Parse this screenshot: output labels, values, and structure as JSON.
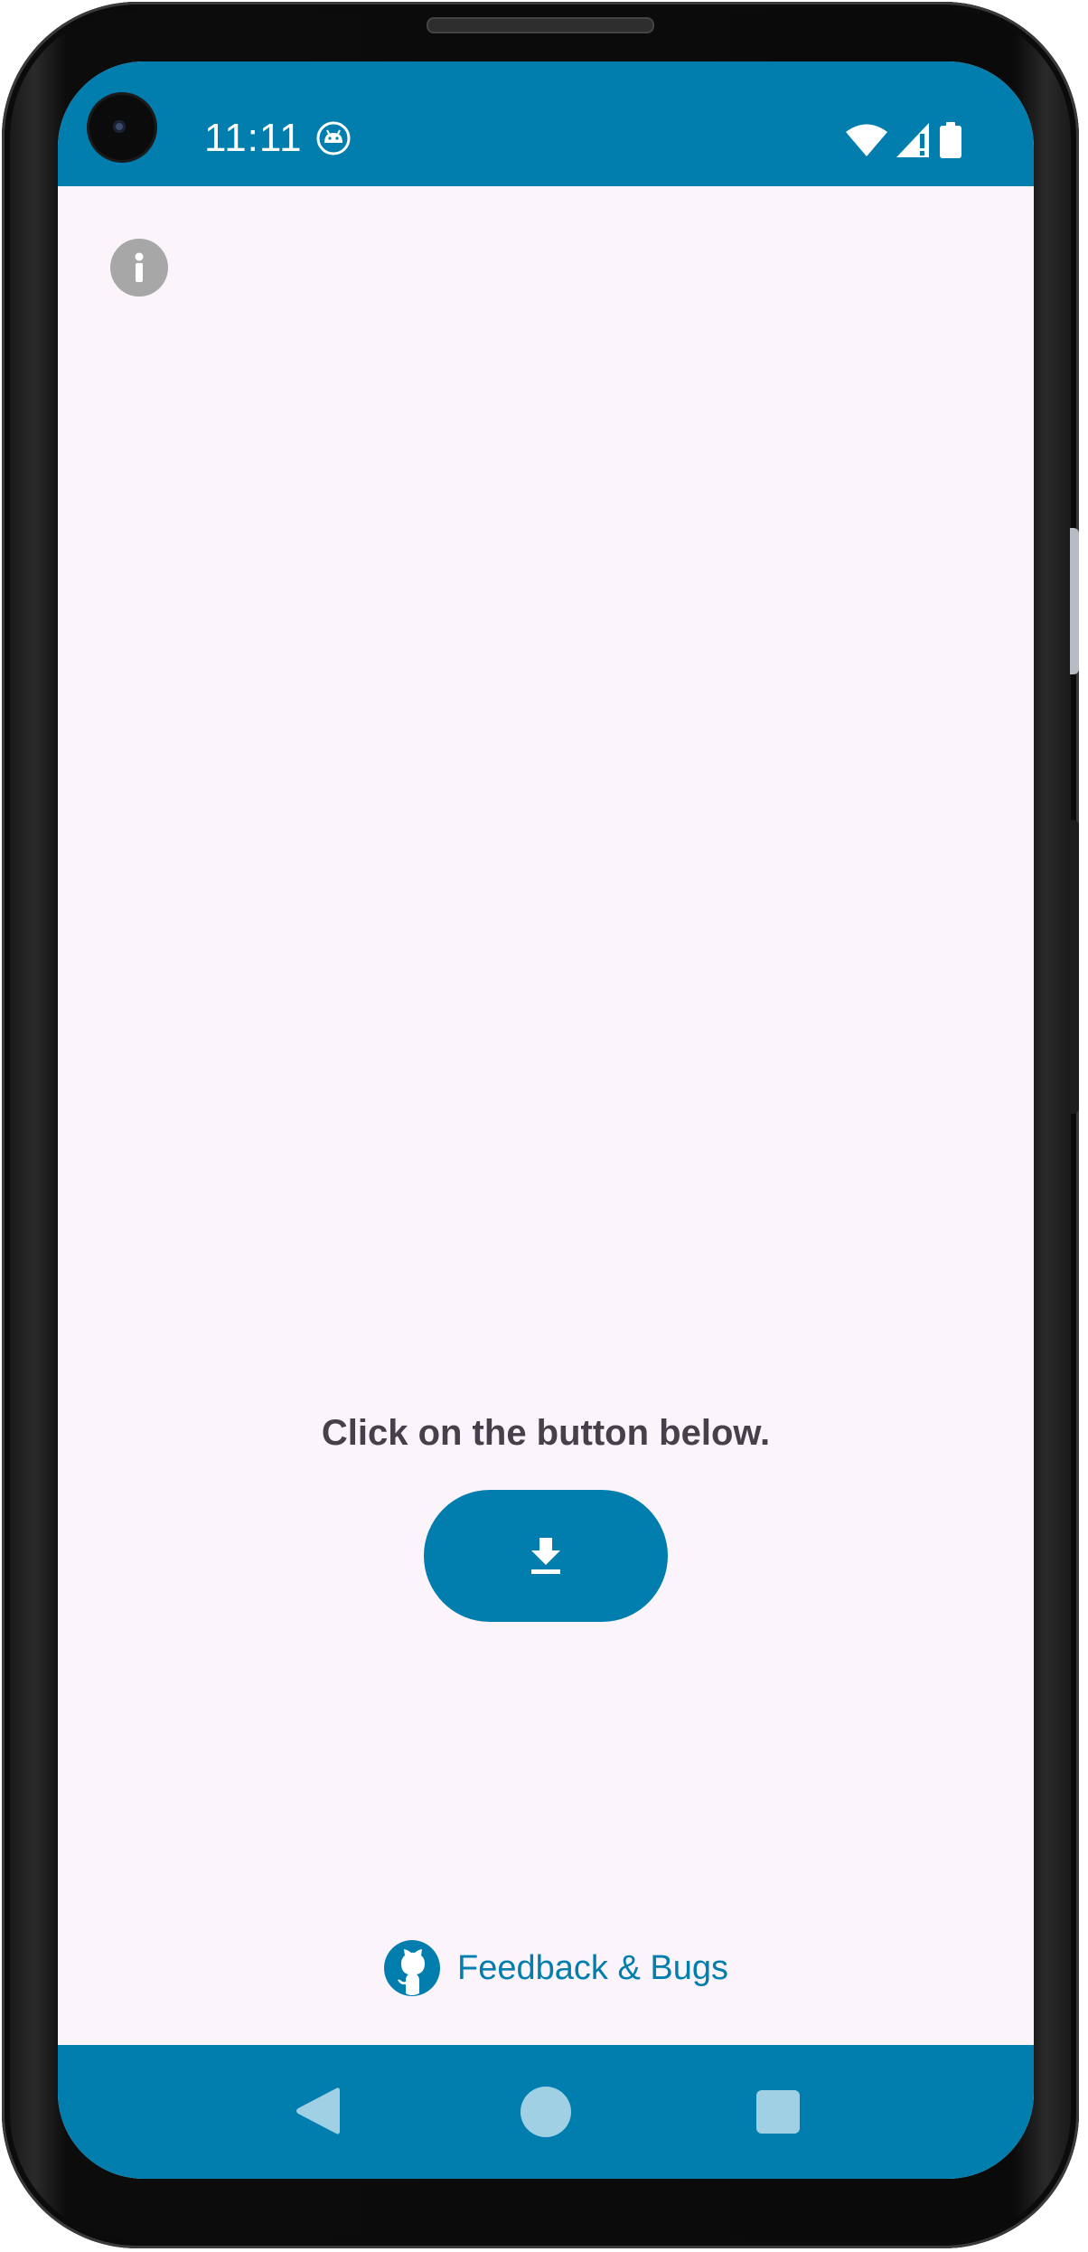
{
  "status_bar": {
    "time": "11:11",
    "notification_icon": "android-robot-icon",
    "icons": [
      "wifi-icon",
      "cell-signal-icon",
      "battery-icon"
    ]
  },
  "info_button": {
    "icon": "info-icon"
  },
  "main": {
    "prompt": "Click on the button below.",
    "download_button": {
      "icon": "download-icon"
    }
  },
  "feedback_link": {
    "icon": "github-icon",
    "label": "Feedback & Bugs"
  },
  "nav_bar": {
    "buttons": [
      "back-icon",
      "home-icon",
      "recents-icon"
    ]
  },
  "colors": {
    "accent": "#017eae",
    "background": "#fcf4fb",
    "text": "#45404a",
    "info_icon_bg": "#a7a7a7",
    "nav_icon": "#9fd0e3"
  }
}
